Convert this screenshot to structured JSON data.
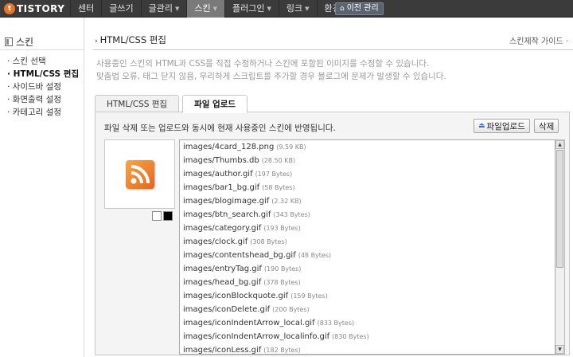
{
  "logo": {
    "text": "TISTORY",
    "mark": "t"
  },
  "nav": {
    "items": [
      {
        "label": "센터",
        "caret": false
      },
      {
        "label": "글쓰기",
        "caret": false
      },
      {
        "label": "글관리",
        "caret": true
      },
      {
        "label": "스킨",
        "caret": true,
        "active": true
      },
      {
        "label": "플러그인",
        "caret": true
      },
      {
        "label": "링크",
        "caret": true
      },
      {
        "label": "환경설정",
        "caret": true
      }
    ],
    "prev_label": "이전 관리"
  },
  "sidebar": {
    "title": "스킨",
    "items": [
      {
        "label": "· 스킨 선택"
      },
      {
        "label": "· HTML/CSS 편집",
        "active": true
      },
      {
        "label": "· 사이드바 설정"
      },
      {
        "label": "· 화면출력 설정"
      },
      {
        "label": "· 카테고리 설정"
      }
    ]
  },
  "main": {
    "title": "HTML/CSS 편집",
    "guide_link": "스킨제작 가이드 ·",
    "desc_line1": "사용중인 스킨의 HTML과 CSS를 직접 수정하거나 스킨에 포함된 이미지를 수정할 수 있습니다.",
    "desc_line2": "맞춤법 오류, 태그 닫지 않음, 무리하게 스크립트를 추가할 경우 블로그에 문제가 발생할 수 있습니다.",
    "tabs": [
      {
        "label": "HTML/CSS 편집"
      },
      {
        "label": "파일 업로드",
        "active": true
      }
    ],
    "info_line": "파일 삭제 또는 업로드와 동시에 현재 사용중인 스킨에 반영됩니다.",
    "upload_label": "파일업로드",
    "delete_label": "삭제",
    "files": [
      {
        "name": "images/4card_128.png",
        "size": "(9.59 KB)"
      },
      {
        "name": "images/Thumbs.db",
        "size": "(28.50 KB)"
      },
      {
        "name": "images/author.gif",
        "size": "(197 Bytes)"
      },
      {
        "name": "images/bar1_bg.gif",
        "size": "(58 Bytes)"
      },
      {
        "name": "images/blogimage.gif",
        "size": "(2.32 KB)"
      },
      {
        "name": "images/btn_search.gif",
        "size": "(343 Bytes)"
      },
      {
        "name": "images/category.gif",
        "size": "(193 Bytes)"
      },
      {
        "name": "images/clock.gif",
        "size": "(308 Bytes)"
      },
      {
        "name": "images/contentshead_bg.gif",
        "size": "(48 Bytes)"
      },
      {
        "name": "images/entryTag.gif",
        "size": "(190 Bytes)"
      },
      {
        "name": "images/head_bg.gif",
        "size": "(378 Bytes)"
      },
      {
        "name": "images/iconBlockquote.gif",
        "size": "(159 Bytes)"
      },
      {
        "name": "images/iconDelete.gif",
        "size": "(200 Bytes)"
      },
      {
        "name": "images/iconIndentArrow_local.gif",
        "size": "(833 Bytes)"
      },
      {
        "name": "images/iconIndentArrow_localinfo.gif",
        "size": "(830 Bytes)"
      },
      {
        "name": "images/iconLess.gif",
        "size": "(182 Bytes)"
      }
    ]
  },
  "colors": {
    "topbar_bg": "#3b3b3b",
    "active_nav_bg": "#7a7a7a",
    "logo_accent": "#e8742a",
    "rss_orange": "#e0681f"
  }
}
